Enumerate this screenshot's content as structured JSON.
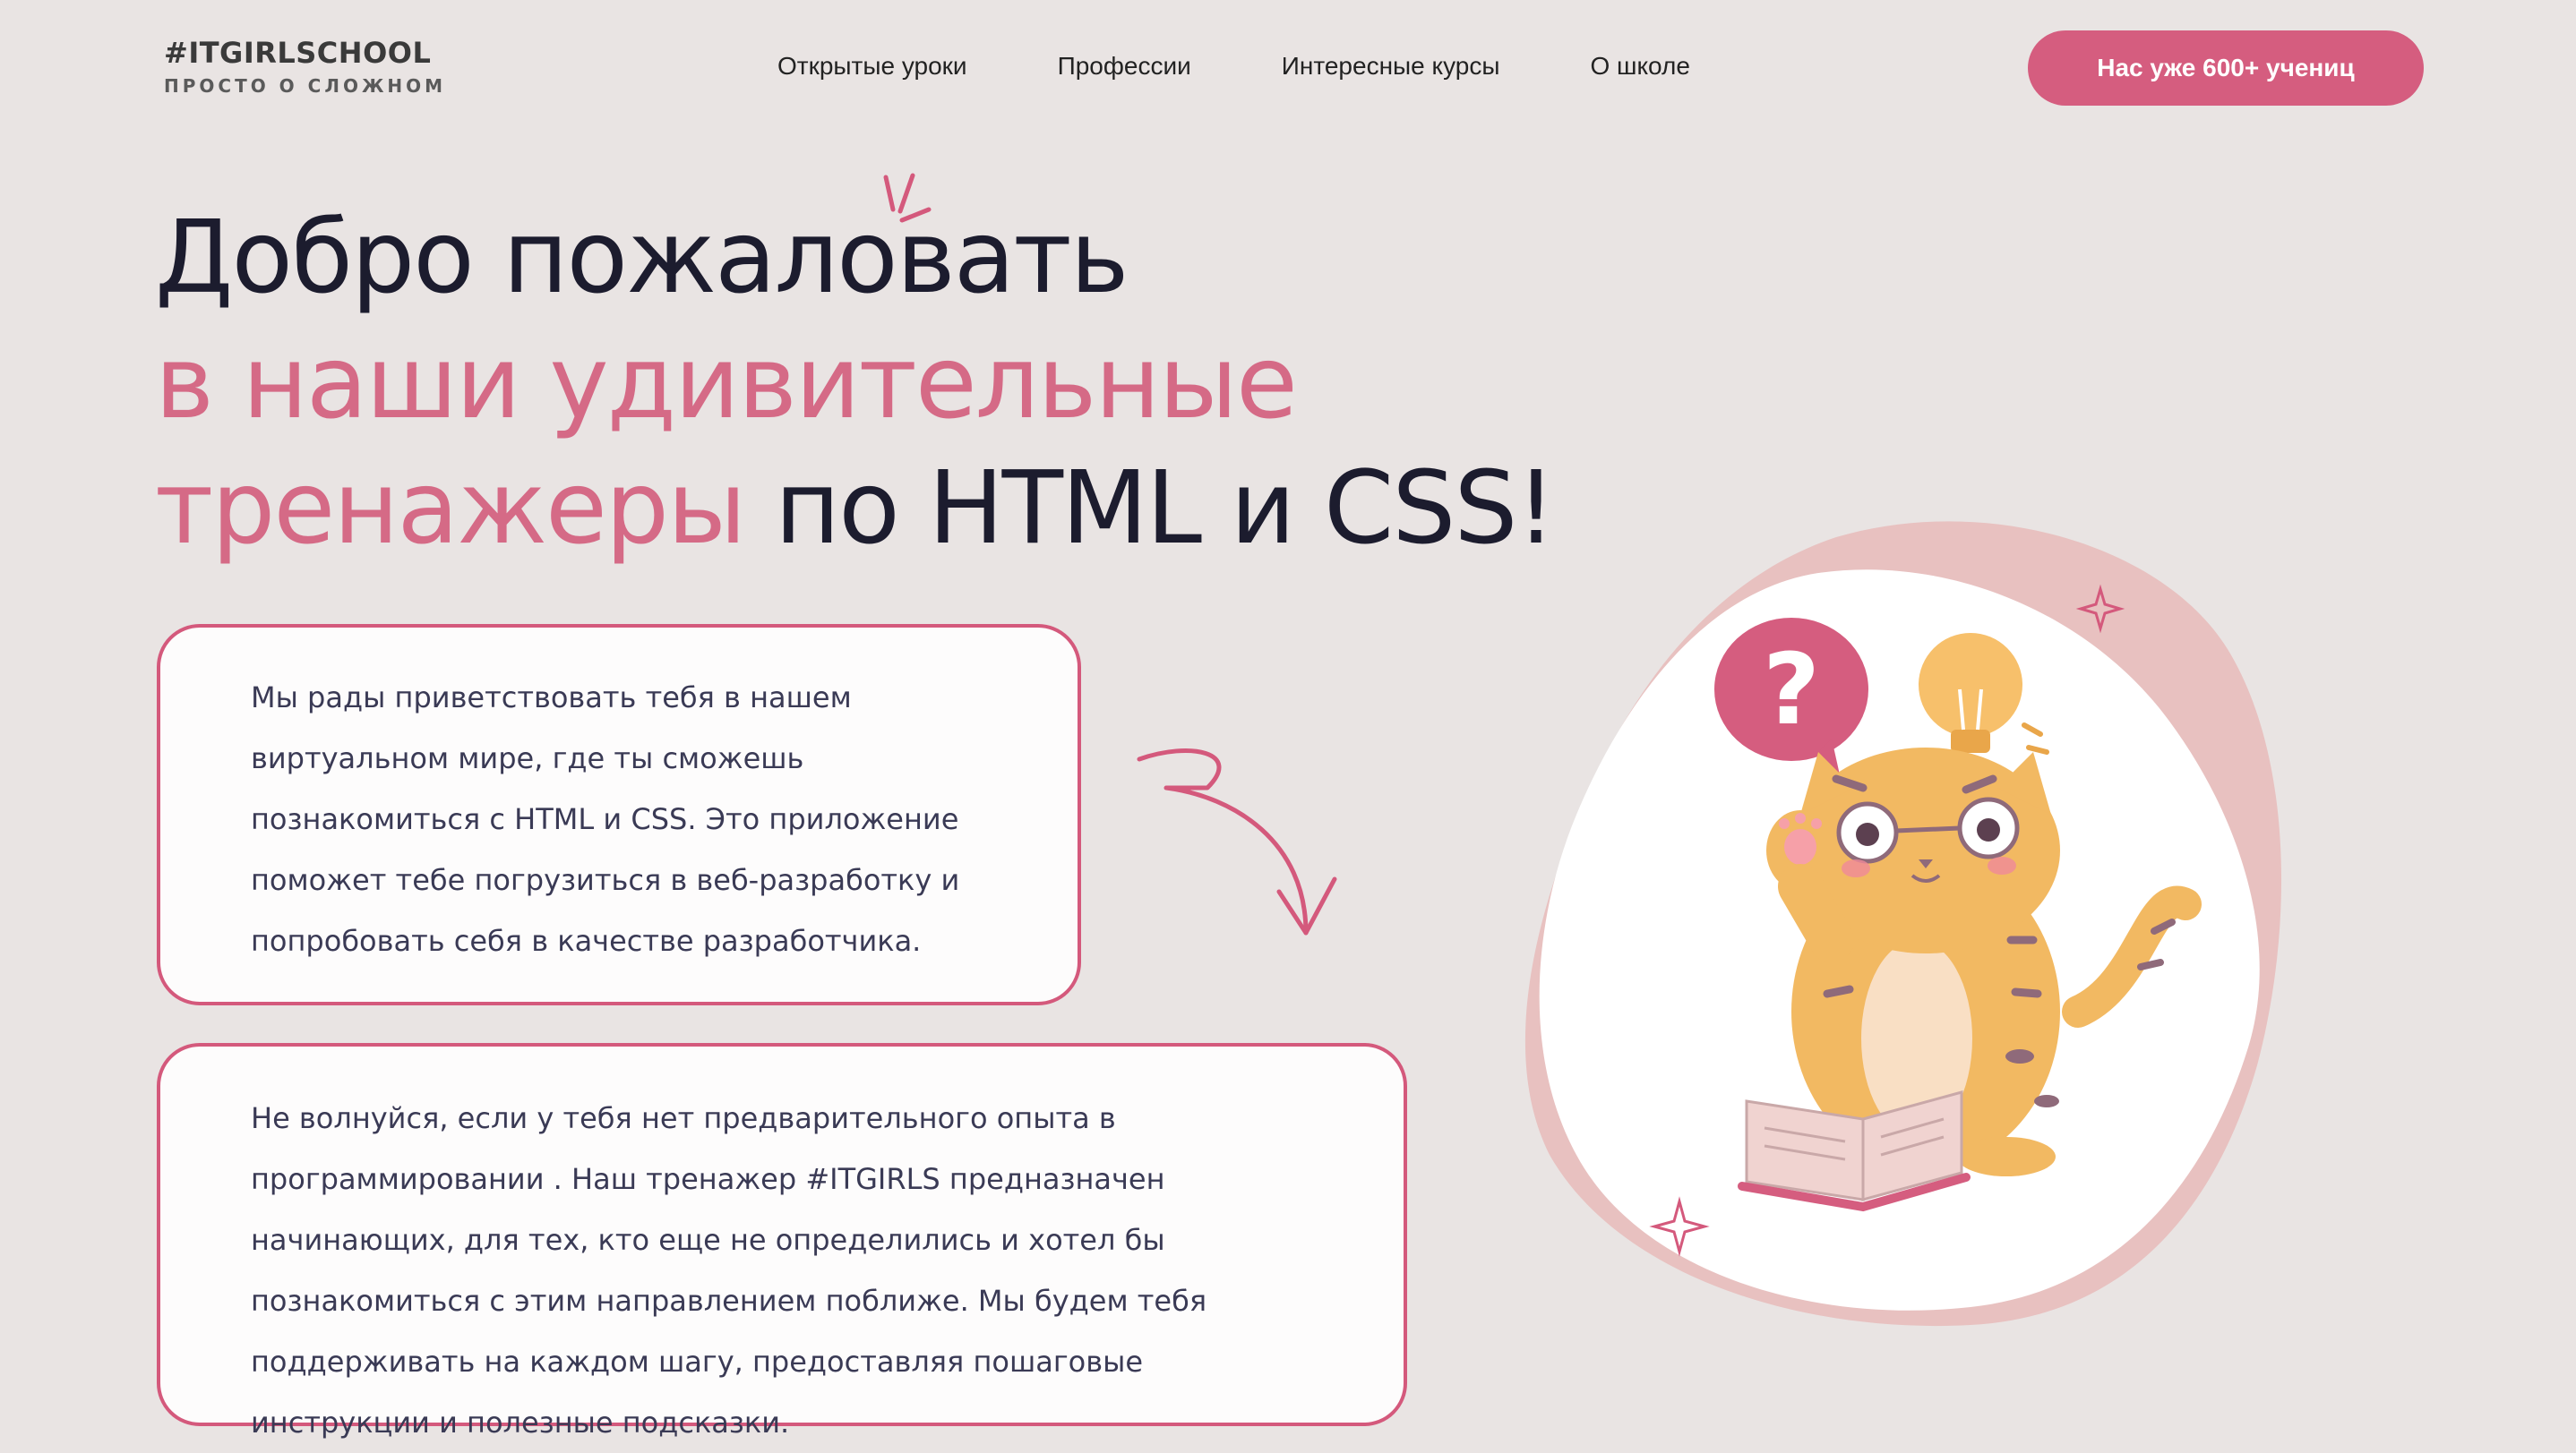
{
  "header": {
    "logo_title": "#ITGIRLSCHOOL",
    "logo_subtitle": "ПРОСТО О СЛОЖНОМ",
    "nav": [
      "Открытые уроки",
      "Профессии",
      "Интересные курсы",
      "О школе"
    ],
    "cta_label": "Нас уже 600+ учениц"
  },
  "hero": {
    "line1": "Добро пожаловать",
    "line2": "в наши удивительные",
    "line3_pink": "тренажеры",
    "line3_dark": " по HTML и CSS!"
  },
  "cards": {
    "welcome": "Мы рады приветствовать тебя в нашем виртуальном мире, где ты сможешь познакомиться с HTML и CSS. Это приложение поможет тебе погрузиться в веб-разработку и попробовать себя в качестве разработчика.",
    "reassure": "Не волнуйся, если у тебя нет предварительного опыта в программировании . Наш тренажер #ITGIRLS предназначен начинающих, для тех, кто еще не определились и хотел бы познакомиться с этим направлением поближе. Мы будем тебя поддерживать на каждом шагу, предоставляя пошаговые инструкции и полезные подсказки."
  },
  "illustration": {
    "question_mark": "?",
    "icons": [
      "question-bubble-icon",
      "light-bulb-icon",
      "cat-illustration",
      "book-icon",
      "sparkle-icon",
      "curved-arrow-icon"
    ]
  },
  "colors": {
    "background": "#e9e4e3",
    "accent": "#d55d7f",
    "pink_text": "#d56a86",
    "dark_text": "#1c1c2e",
    "blob": "#e8c1c0"
  }
}
